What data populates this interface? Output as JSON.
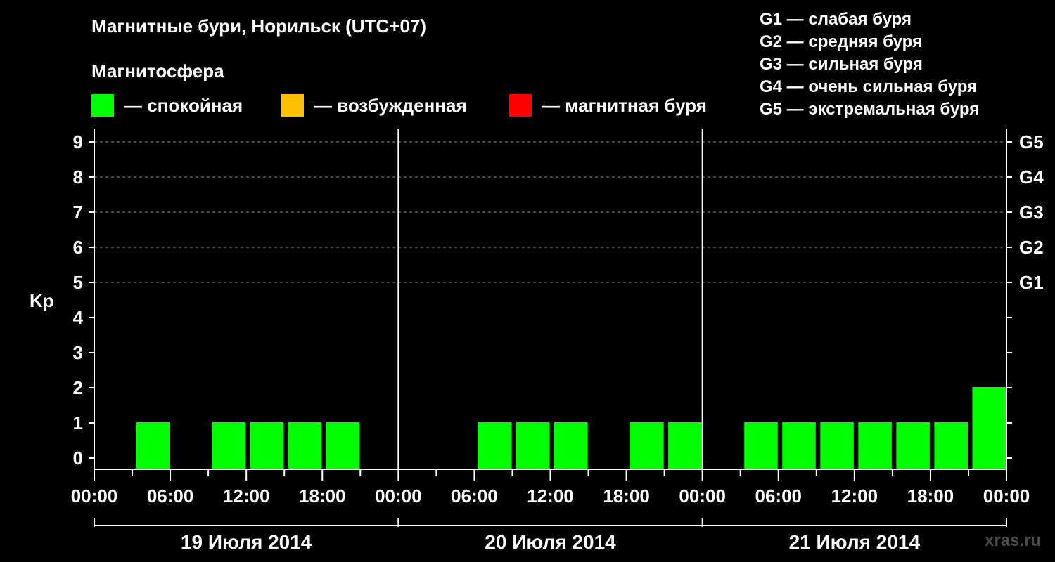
{
  "title": "Магнитные бури, Норильск (UTC+07)",
  "magnetosphere_label": "Магнитосфера",
  "legend": [
    {
      "label": "— спокойная",
      "color": "#00ff00"
    },
    {
      "label": "— возбужденная",
      "color": "#ffc000"
    },
    {
      "label": "— магнитная буря",
      "color": "#ff0000"
    }
  ],
  "storm_scale": [
    "G1 — слабая буря",
    "G2 — средняя буря",
    "G3 — сильная буря",
    "G4 — очень сильная буря",
    "G5 — экстремальная буря"
  ],
  "watermark": "xras.ru",
  "chart_data": {
    "type": "bar",
    "ylabel": "Kp",
    "ylim": [
      0,
      9
    ],
    "yticks": [
      0,
      1,
      2,
      3,
      4,
      5,
      6,
      7,
      8,
      9
    ],
    "right_axis_labels": [
      {
        "kp": 5,
        "label": "G1"
      },
      {
        "kp": 6,
        "label": "G2"
      },
      {
        "kp": 7,
        "label": "G3"
      },
      {
        "kp": 8,
        "label": "G4"
      },
      {
        "kp": 9,
        "label": "G5"
      }
    ],
    "grid": "dashed horizontal at Kp 5-9",
    "xtick_labels": [
      "00:00",
      "06:00",
      "12:00",
      "18:00",
      "00:00",
      "06:00",
      "12:00",
      "18:00",
      "00:00",
      "06:00",
      "12:00",
      "18:00",
      "00:00"
    ],
    "days": [
      "19 Июля 2014",
      "20 Июля 2014",
      "21 Июля 2014"
    ],
    "interval_hours": 3,
    "series": [
      {
        "values": [
          0,
          1,
          0,
          1,
          1,
          1,
          1,
          0,
          0,
          0,
          1,
          1,
          1,
          0,
          1,
          1,
          0,
          1,
          1,
          1,
          1,
          1,
          1,
          2
        ]
      }
    ],
    "bar_colors": [
      "#00ff00",
      "#00ff00",
      "#00ff00",
      "#00ff00",
      "#00ff00",
      "#00ff00",
      "#00ff00",
      "#00ff00",
      "#00ff00",
      "#00ff00",
      "#00ff00",
      "#00ff00",
      "#00ff00",
      "#00ff00",
      "#00ff00",
      "#00ff00",
      "#00ff00",
      "#00ff00",
      "#00ff00",
      "#00ff00",
      "#00ff00",
      "#00ff00",
      "#00ff00",
      "#00ff00"
    ]
  }
}
